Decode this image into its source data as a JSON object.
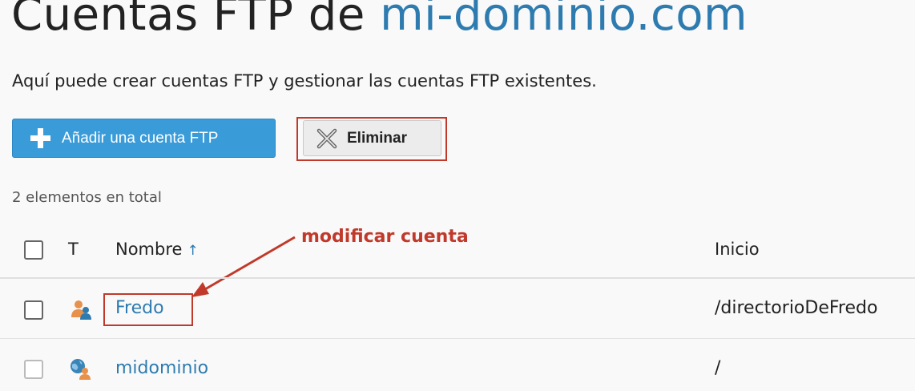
{
  "header": {
    "title_prefix": "Cuentas FTP de",
    "title_domain": "mi-dominio.com"
  },
  "intro": "Aquí puede crear cuentas FTP y gestionar las cuentas FTP existentes.",
  "toolbar": {
    "add_label": "Añadir una cuenta FTP",
    "delete_label": "Eliminar"
  },
  "total_label": "2 elementos en total",
  "annotation": "modificar cuenta",
  "table": {
    "columns": {
      "type": "T",
      "name": "Nombre",
      "sort_indicator": "↑",
      "home": "Inicio"
    },
    "rows": [
      {
        "name": "Fredo",
        "home": "/directorioDeFredo",
        "type_icon": "user-icon"
      },
      {
        "name": "midominio",
        "home": "/",
        "type_icon": "globe-user-icon"
      }
    ]
  },
  "colors": {
    "accent": "#3a9bd9",
    "link": "#2e7bb0",
    "annotation": "#c0392b"
  }
}
